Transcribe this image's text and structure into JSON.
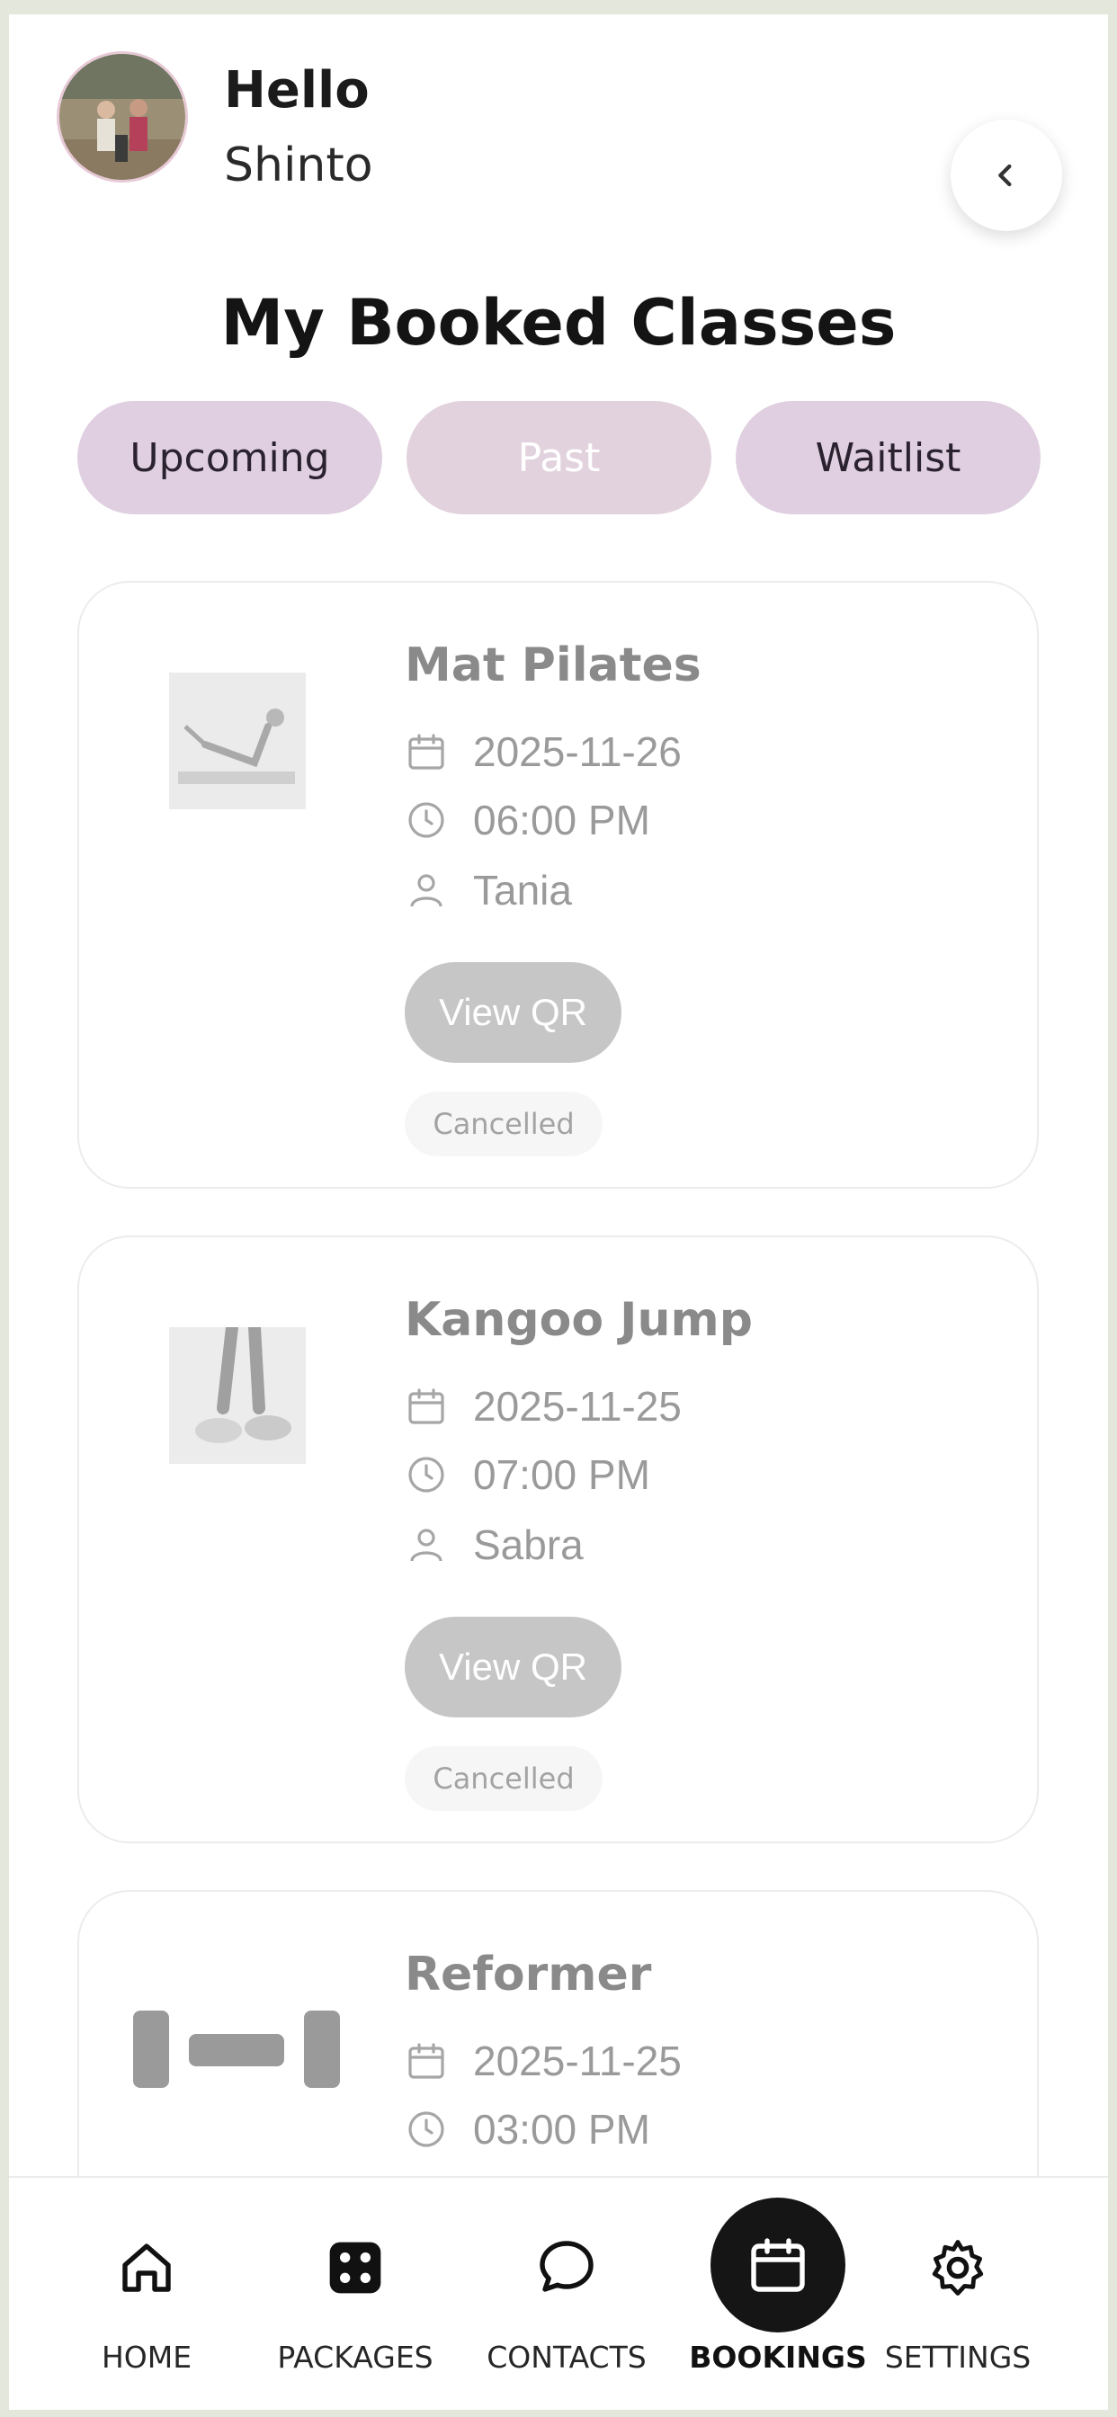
{
  "header": {
    "greeting": "Hello",
    "user_name": "Shinto",
    "back_icon": "chevron-left-icon"
  },
  "page": {
    "title": "My Booked Classes"
  },
  "tabs": [
    {
      "label": "Upcoming",
      "selected": false
    },
    {
      "label": "Past",
      "selected": true
    },
    {
      "label": "Waitlist",
      "selected": false
    }
  ],
  "bookings": [
    {
      "class_name": "Mat Pilates",
      "date": "2025-11-26",
      "time": "06:00 PM",
      "instructor": "Tania",
      "qr_label": "View QR",
      "status": "Cancelled"
    },
    {
      "class_name": "Kangoo Jump",
      "date": "2025-11-25",
      "time": "07:00 PM",
      "instructor": "Sabra",
      "qr_label": "View QR",
      "status": "Cancelled"
    },
    {
      "class_name": "Reformer",
      "date": "2025-11-25",
      "time": "03:00 PM"
    }
  ],
  "nav": [
    {
      "label": "HOME",
      "icon": "home-icon"
    },
    {
      "label": "PACKAGES",
      "icon": "grid-icon"
    },
    {
      "label": "CONTACTS",
      "icon": "chat-icon"
    },
    {
      "label": "BOOKINGS",
      "icon": "calendar-icon",
      "active": true
    },
    {
      "label": "SETTINGS",
      "icon": "gear-icon"
    }
  ],
  "colors": {
    "background": "#e3e7dc",
    "tab_fill": "#e0cfe0",
    "tab_selected_fill": "#e2d2dd",
    "qr_button": "#c6c6c6",
    "nav_active": "#151515"
  }
}
